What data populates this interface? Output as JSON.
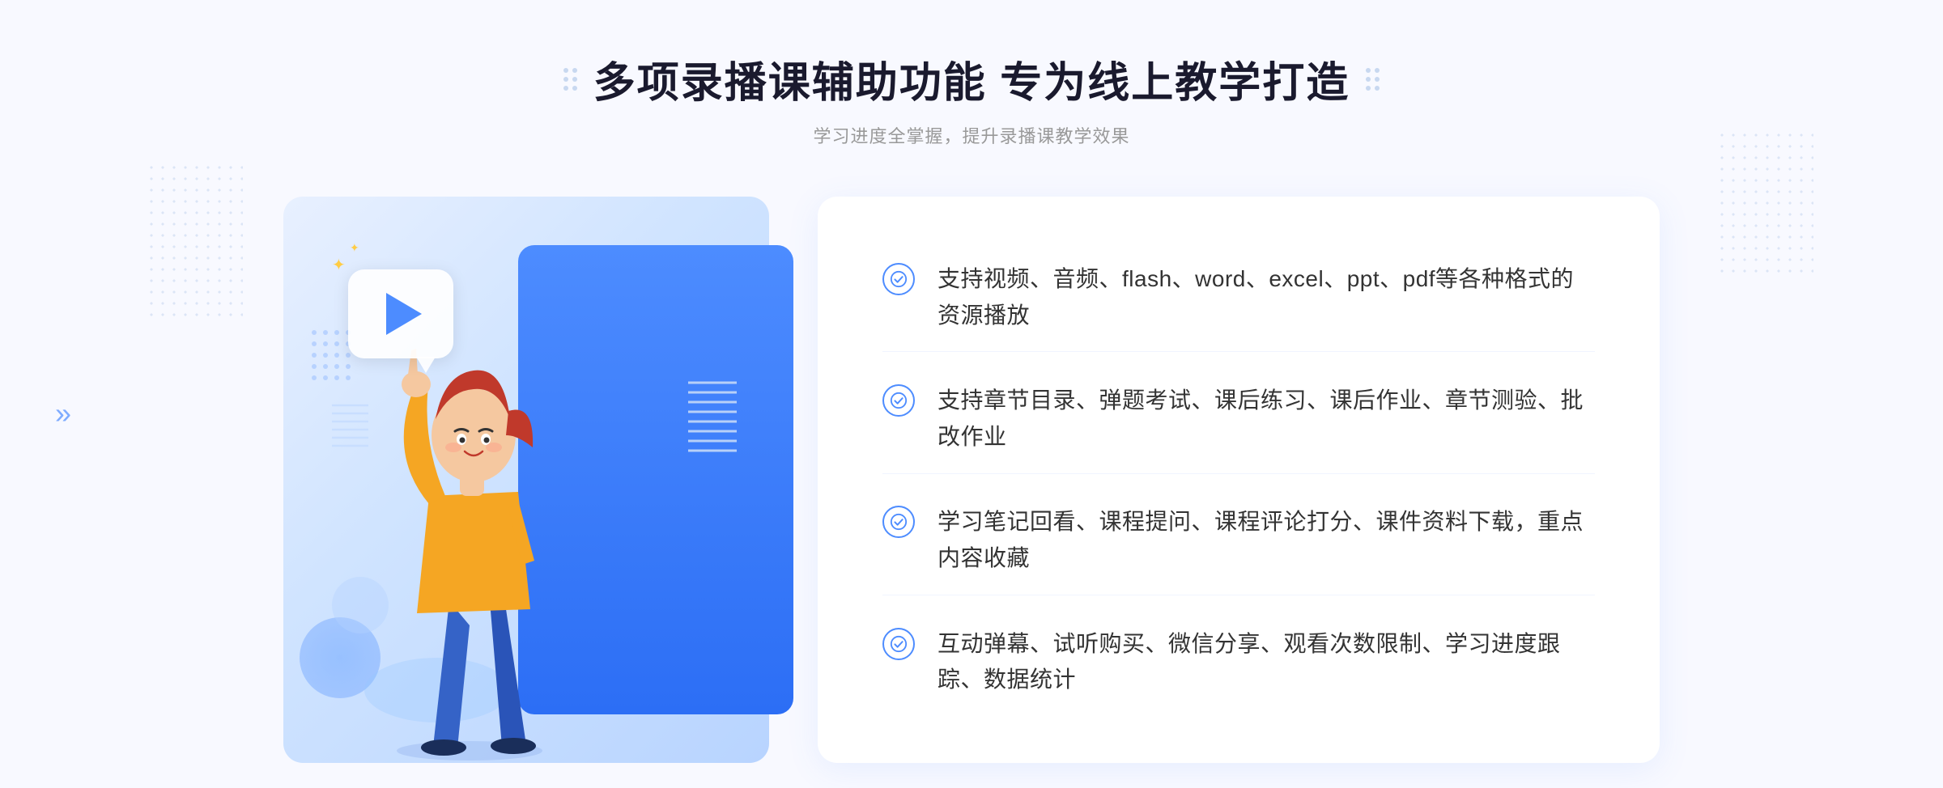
{
  "header": {
    "title": "多项录播课辅助功能 专为线上教学打造",
    "subtitle": "学习进度全掌握，提升录播课教学效果"
  },
  "decorative": {
    "chevron": "»"
  },
  "features": [
    {
      "id": 1,
      "text": "支持视频、音频、flash、word、excel、ppt、pdf等各种格式的资源播放"
    },
    {
      "id": 2,
      "text": "支持章节目录、弹题考试、课后练习、课后作业、章节测验、批改作业"
    },
    {
      "id": 3,
      "text": "学习笔记回看、课程提问、课程评论打分、课件资料下载，重点内容收藏"
    },
    {
      "id": 4,
      "text": "互动弹幕、试听购买、微信分享、观看次数限制、学习进度跟踪、数据统计"
    }
  ]
}
